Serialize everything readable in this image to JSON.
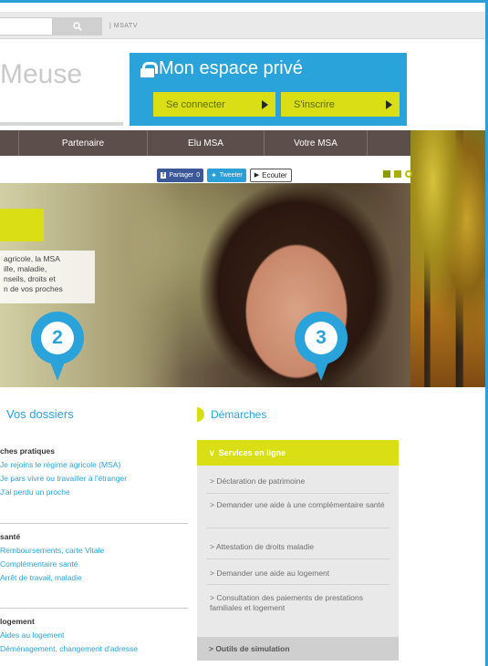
{
  "topbar": {
    "search_icon": "search-icon",
    "site_link": "| MSATV"
  },
  "header": {
    "brand": "Meuse",
    "espace_title": "Mon espace privé",
    "connect_label": "Se connecter",
    "inscrire_label": "S'inscrire"
  },
  "nav": {
    "items": [
      "Partenaire",
      "Elu MSA",
      "Votre MSA"
    ]
  },
  "social": {
    "facebook": "Partager",
    "facebook_count": "0",
    "twitter": "Tweeter",
    "ecouter": "Ecouter"
  },
  "hero": {
    "text_lines": [
      "agricole, la MSA",
      "ille, maladie,",
      "nseils, droits et",
      "n de vos proches"
    ]
  },
  "pins": [
    "2",
    "3"
  ],
  "dossiers": {
    "title": "Vos dossiers",
    "sections": [
      {
        "head": "ches pratiques",
        "links": [
          "Je rejoins le régime agricole (MSA)",
          "Je pars vivre ou travailler à l'étranger",
          "J'ai perdu un proche"
        ]
      },
      {
        "head": "santé",
        "links": [
          "Remboursements, carte Vitale",
          "Complémentaire santé",
          "Arrêt de travail, maladie"
        ]
      },
      {
        "head": "logement",
        "links": [
          "Aides au logement",
          "Déménagement, changement d'adresse"
        ]
      }
    ]
  },
  "demarches": {
    "title": "Démarches",
    "services_label": "Services en ligne",
    "items": [
      "> Déclaration de patrimoine",
      "> Demander une aide à une complémentaire santé",
      "> Attestation de droits maladie",
      "> Demander une aide au logement",
      "> Consultation des paiements de prestations familiales et logement"
    ],
    "outils_label": "> Outils de simulation"
  },
  "colors": {
    "accent_blue": "#2aa3da",
    "accent_yellow": "#d9df14",
    "nav_brown": "#5c4e4a"
  }
}
